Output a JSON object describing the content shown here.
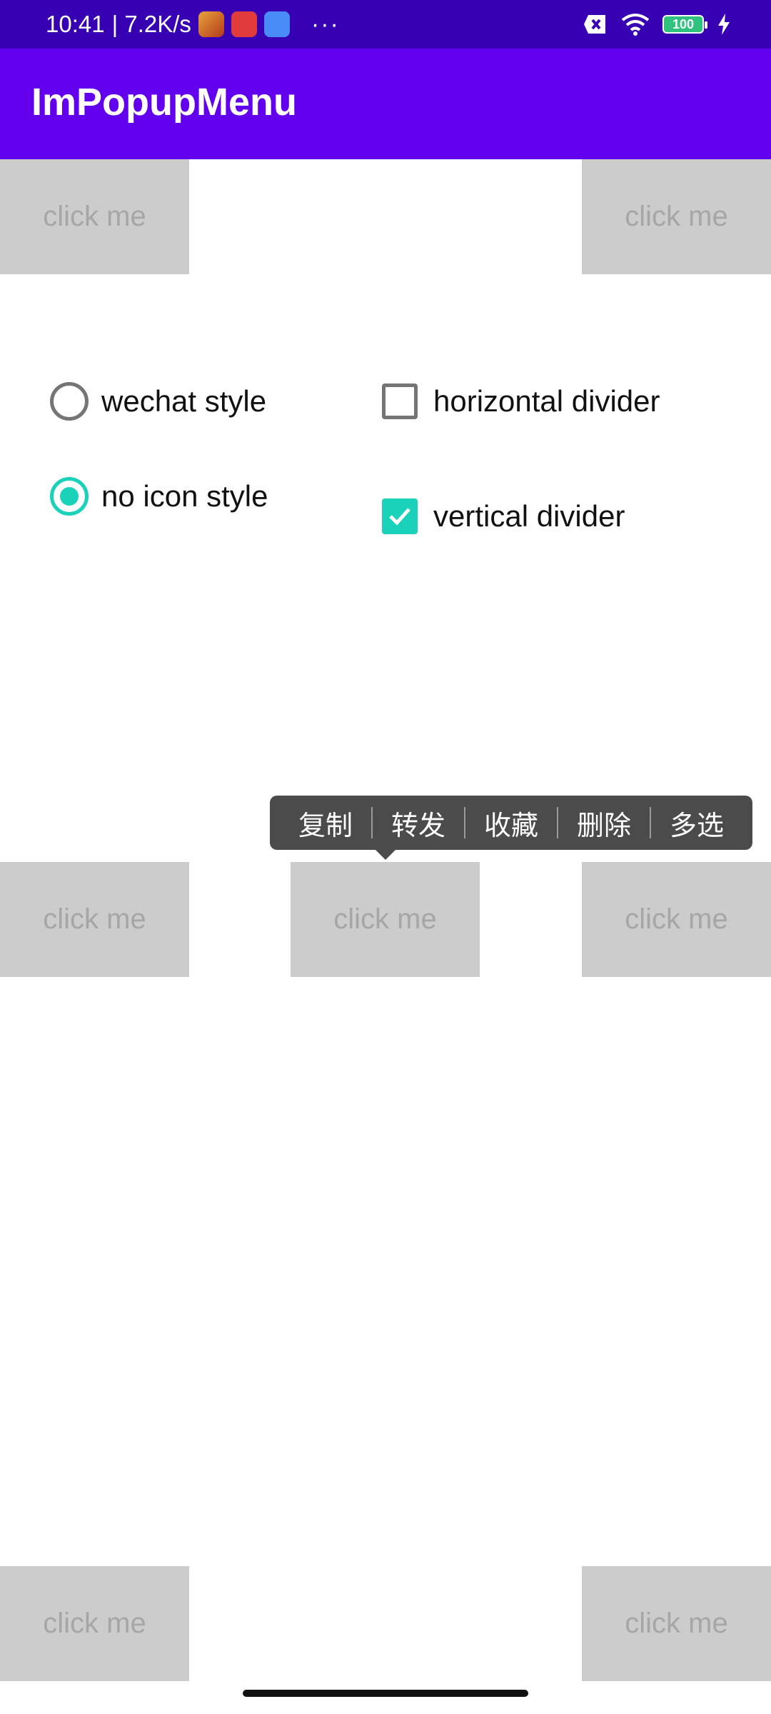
{
  "status_bar": {
    "time": "10:41",
    "speed": "| 7.2K/s",
    "more": "···",
    "battery": "100"
  },
  "app_bar": {
    "title": "ImPopupMenu"
  },
  "click_boxes": {
    "label": "click me"
  },
  "options": {
    "wechat_style": "wechat style",
    "no_icon_style": "no icon style",
    "horizontal_divider": "horizontal divider",
    "vertical_divider": "vertical divider"
  },
  "popup_menu": {
    "items": [
      "复制",
      "转发",
      "收藏",
      "删除",
      "多选"
    ]
  },
  "colors": {
    "status_bar": "#3700b3",
    "app_bar": "#6200ee",
    "accent": "#1ad1b9",
    "box": "#cccccc",
    "popup": "#4b4b4b"
  }
}
